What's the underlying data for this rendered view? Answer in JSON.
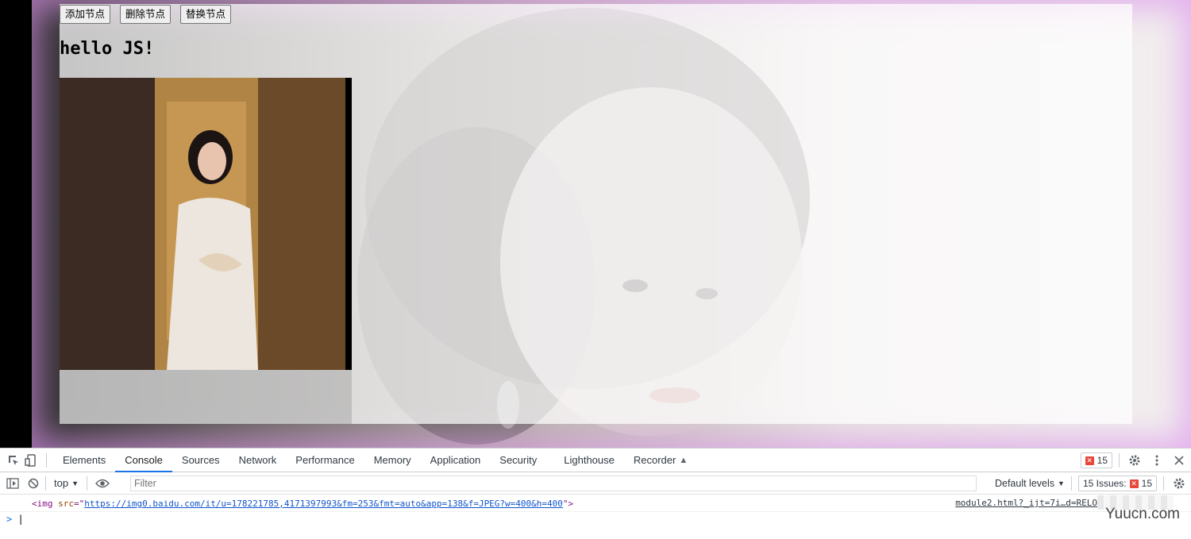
{
  "page": {
    "buttons": {
      "add": "添加节点",
      "remove": "删除节点",
      "replace": "替换节点"
    },
    "heading": "hello JS!"
  },
  "devtools": {
    "tabs": [
      "Elements",
      "Console",
      "Sources",
      "Network",
      "Performance",
      "Memory",
      "Application",
      "Security",
      "Lighthouse",
      "Recorder"
    ],
    "active_tab": "Console",
    "error_count": "15",
    "context": "top",
    "filter_placeholder": "Filter",
    "levels": "Default levels",
    "issues_label": "15 Issues:",
    "issues_count": "15",
    "log": {
      "tag_open": "<img ",
      "attr_name": "src",
      "eq_quote": "=\"",
      "url": "https://img0.baidu.com/it/u=178221785,4171397993&fm=253&fmt=auto&app=138&f=JPEG?w=400&h=400",
      "tag_close": "\">",
      "source": "module2.html?_ijt=7i…d=RELO"
    },
    "prompt": ">"
  },
  "watermark": "Yuucn.com",
  "colors": {
    "accent": "#1a73e8",
    "error": "#e8473c",
    "glow": "#dc96eb"
  }
}
